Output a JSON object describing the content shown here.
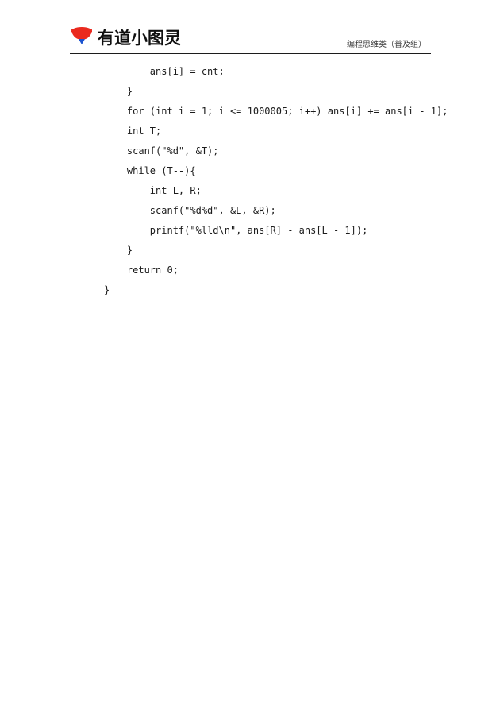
{
  "header": {
    "logo_icon": "youdao-bowl-logo-icon",
    "brand_name": "有道小图灵",
    "category": "编程思维类（普及组）",
    "brand_red": "#ea2a1f",
    "brand_blue": "#1b53d0",
    "rule_color": "#1c1c1c"
  },
  "code": {
    "language": "c",
    "text_color": "#1b1b1b",
    "lines": [
      "        ans[i] = cnt;",
      "    }",
      "    for (int i = 1; i <= 1000005; i++) ans[i] += ans[i - 1];",
      "    int T;",
      "    scanf(\"%d\", &T);",
      "    while (T--){",
      "        int L, R;",
      "        scanf(\"%d%d\", &L, &R);",
      "        printf(\"%lld\\n\", ans[R] - ans[L - 1]);",
      "    }",
      "    return 0;",
      "}"
    ]
  }
}
